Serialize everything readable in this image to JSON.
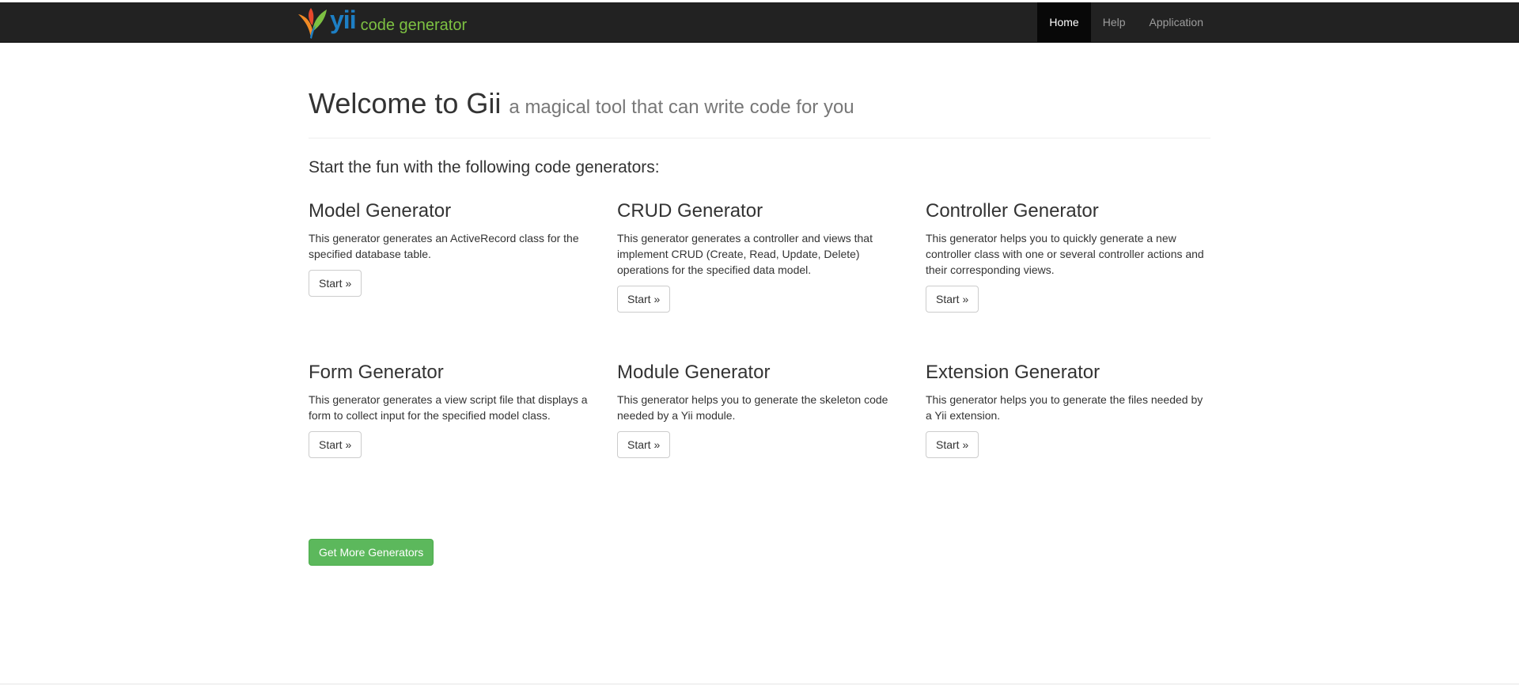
{
  "navbar": {
    "brand_logo_text": "yii",
    "brand_text": "code generator",
    "items": [
      {
        "label": "Home",
        "active": true
      },
      {
        "label": "Help",
        "active": false
      },
      {
        "label": "Application",
        "active": false
      }
    ]
  },
  "header": {
    "title": "Welcome to Gii",
    "subtitle": "a magical tool that can write code for you"
  },
  "lead": "Start the fun with the following code generators:",
  "generators": [
    {
      "name": "Model Generator",
      "description": "This generator generates an ActiveRecord class for the specified database table.",
      "button": "Start »"
    },
    {
      "name": "CRUD Generator",
      "description": "This generator generates a controller and views that implement CRUD (Create, Read, Update, Delete) operations for the specified data model.",
      "button": "Start »"
    },
    {
      "name": "Controller Generator",
      "description": "This generator helps you to quickly generate a new controller class with one or several controller actions and their corresponding views.",
      "button": "Start »"
    },
    {
      "name": "Form Generator",
      "description": "This generator generates a view script file that displays a form to collect input for the specified model class.",
      "button": "Start »"
    },
    {
      "name": "Module Generator",
      "description": "This generator helps you to generate the skeleton code needed by a Yii module.",
      "button": "Start »"
    },
    {
      "name": "Extension Generator",
      "description": "This generator helps you to generate the files needed by a Yii extension.",
      "button": "Start »"
    }
  ],
  "more_button": "Get More Generators",
  "colors": {
    "navbar_bg": "#222222",
    "nav_active_bg": "#080808",
    "success": "#5cb85c",
    "brand_blue": "#1d7fc4",
    "brand_green": "#7dc142"
  }
}
